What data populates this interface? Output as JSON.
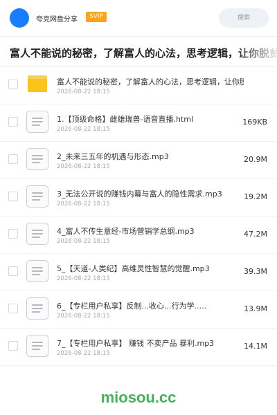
{
  "header": {
    "user_name": "夸克网盘分享",
    "badge": "SVIP",
    "search_placeholder": "搜索"
  },
  "title": "富人不能说的秘密，了解富人的心法，思考逻辑，让你脱贫",
  "items": [
    {
      "type": "folder",
      "name": "富人不能说的秘密，了解富人的心法，思考逻辑，让你脱…",
      "date": "2026-08-22 18:15",
      "size": ""
    },
    {
      "type": "file",
      "name": "1.【顶级命格】雌雄瑞兽-语音直播.html",
      "date": "2026-08-22 18:15",
      "size": "169KB"
    },
    {
      "type": "file",
      "name": "2_未来三五年的机遇与形态.mp3",
      "date": "2026-08-22 18:15",
      "size": "20.9M"
    },
    {
      "type": "file",
      "name": "3_无法公开说的赚钱内幕与富人的隐性需求.mp3",
      "date": "2026-08-22 18:15",
      "size": "19.2M"
    },
    {
      "type": "file",
      "name": "4_富人不传生意经-市场营销学总纲.mp3",
      "date": "2026-08-22 18:15",
      "size": "47.2M"
    },
    {
      "type": "file",
      "name": "5_【天道-人类纪】高维灵性智慧的觉醒.mp3",
      "date": "2026-08-22 18:15",
      "size": "39.3M"
    },
    {
      "type": "file",
      "name": "6_【专栏用户私享】反制...收心...行为学..…",
      "date": "2026-08-22 18:15",
      "size": "13.9M"
    },
    {
      "type": "file",
      "name": "7_【专栏用户私享】 赚钱 不卖产品 暴利.mp3",
      "date": "2026-08-22 18:15",
      "size": "14.1M"
    }
  ],
  "watermark": "miosou.cc"
}
